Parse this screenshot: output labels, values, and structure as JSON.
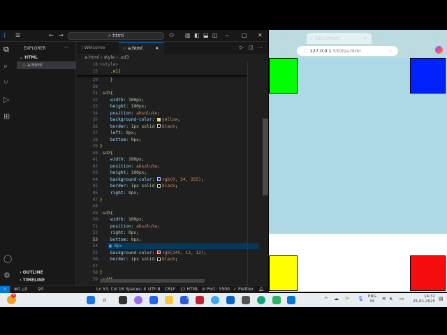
{
  "vscode": {
    "search": "html",
    "explorer_label": "EXPLORER",
    "folder": "HTML",
    "file": "a.html",
    "outline": "OUTLINE",
    "timeline": "TIMELINE",
    "tabs": [
      {
        "label": "Welcome"
      },
      {
        "label": "a.html"
      }
    ],
    "breadcrumb": [
      "a.html",
      "style",
      ".sd3"
    ],
    "sticky": [
      {
        "n": "18",
        "t": "<style>"
      },
      {
        "n": "25",
        "t": "    .m1{"
      }
    ],
    "lines": [
      {
        "n": "29",
        "segs": [
          [
            "    }",
            "br"
          ]
        ]
      },
      {
        "n": "30",
        "segs": []
      },
      {
        "n": "31",
        "segs": [
          [
            ".sd1",
            "sel"
          ],
          [
            "{",
            "br"
          ]
        ]
      },
      {
        "n": "32",
        "segs": [
          [
            "    width",
            "prop"
          ],
          [
            ": ",
            "pun"
          ],
          [
            "100px",
            "num"
          ],
          [
            ";",
            "pun"
          ]
        ]
      },
      {
        "n": "33",
        "segs": [
          [
            "    height",
            "prop"
          ],
          [
            ": ",
            "pun"
          ],
          [
            "100px",
            "num"
          ],
          [
            ";",
            "pun"
          ]
        ]
      },
      {
        "n": "34",
        "segs": [
          [
            "    position",
            "prop"
          ],
          [
            ": ",
            "pun"
          ],
          [
            "absolute",
            "val"
          ],
          [
            ";",
            "pun"
          ]
        ]
      },
      {
        "n": "35",
        "segs": [
          [
            "    background-color",
            "prop"
          ],
          [
            ": ",
            "pun"
          ],
          [
            "yellow",
            "val",
            "#ffff00"
          ],
          [
            ";",
            "pun"
          ]
        ]
      },
      {
        "n": "36",
        "segs": [
          [
            "    border",
            "prop"
          ],
          [
            ": ",
            "pun"
          ],
          [
            "1px solid ",
            "num"
          ],
          [
            "black",
            "val",
            "#000000"
          ],
          [
            ";",
            "pun"
          ]
        ]
      },
      {
        "n": "37",
        "segs": [
          [
            "    left",
            "prop"
          ],
          [
            ": ",
            "pun"
          ],
          [
            "0px",
            "num"
          ],
          [
            ";",
            "pun"
          ]
        ]
      },
      {
        "n": "38",
        "segs": [
          [
            "    bottom",
            "prop"
          ],
          [
            ": ",
            "pun"
          ],
          [
            "0px",
            "num"
          ],
          [
            ";",
            "pun"
          ]
        ]
      },
      {
        "n": "39",
        "segs": [
          [
            "}",
            "br"
          ]
        ]
      },
      {
        "n": "40",
        "segs": [
          [
            ".sd2",
            "sel"
          ],
          [
            "{",
            "br"
          ]
        ]
      },
      {
        "n": "41",
        "segs": [
          [
            "    width",
            "prop"
          ],
          [
            ": ",
            "pun"
          ],
          [
            "100px",
            "num"
          ],
          [
            ";",
            "pun"
          ]
        ]
      },
      {
        "n": "42",
        "segs": [
          [
            "    position",
            "prop"
          ],
          [
            ": ",
            "pun"
          ],
          [
            "absolute",
            "val"
          ],
          [
            ";",
            "pun"
          ]
        ]
      },
      {
        "n": "43",
        "segs": [
          [
            "    height",
            "prop"
          ],
          [
            ": ",
            "pun"
          ],
          [
            "100px",
            "num"
          ],
          [
            ";",
            "pun"
          ]
        ]
      },
      {
        "n": "44",
        "segs": [
          [
            "    background-color",
            "prop"
          ],
          [
            ": ",
            "pun"
          ],
          [
            "rgb(0, 34, 255)",
            "val",
            "#0022ff"
          ],
          [
            ";",
            "pun"
          ]
        ]
      },
      {
        "n": "45",
        "segs": [
          [
            "    border",
            "prop"
          ],
          [
            ": ",
            "pun"
          ],
          [
            "1px solid ",
            "num"
          ],
          [
            "black",
            "val",
            "#000000"
          ],
          [
            ";",
            "pun"
          ]
        ]
      },
      {
        "n": "46",
        "segs": [
          [
            "    right",
            "prop"
          ],
          [
            ": ",
            "pun"
          ],
          [
            "0px",
            "num"
          ],
          [
            ";",
            "pun"
          ]
        ]
      },
      {
        "n": "47",
        "segs": [
          [
            "}",
            "br"
          ]
        ]
      },
      {
        "n": "48",
        "segs": []
      },
      {
        "n": "49",
        "segs": [
          [
            ".sd3",
            "sel"
          ],
          [
            "{",
            "br"
          ]
        ]
      },
      {
        "n": "50",
        "segs": [
          [
            "    width",
            "prop"
          ],
          [
            ": ",
            "pun"
          ],
          [
            "100px",
            "num"
          ],
          [
            ";",
            "pun"
          ]
        ]
      },
      {
        "n": "51",
        "segs": [
          [
            "    position",
            "prop"
          ],
          [
            ": ",
            "pun"
          ],
          [
            "absolute",
            "val"
          ],
          [
            ";",
            "pun"
          ]
        ]
      },
      {
        "n": "52",
        "segs": [
          [
            "    right",
            "prop"
          ],
          [
            ": ",
            "pun"
          ],
          [
            "0px",
            "num"
          ],
          [
            ";",
            "pun"
          ]
        ]
      },
      {
        "n": "53",
        "segs": [
          [
            "    bottom",
            "prop"
          ],
          [
            ": ",
            "pun"
          ],
          [
            "0px",
            "num"
          ],
          [
            ";",
            "pun"
          ]
        ]
      },
      {
        "n": "54",
        "segs": []
      },
      {
        "n": "55",
        "segs": [
          [
            "    background-color",
            "prop"
          ],
          [
            ": ",
            "pun"
          ],
          [
            "rgb(245, 12, 12)",
            "val",
            "#f50c0c"
          ],
          [
            ";",
            "pun"
          ]
        ]
      },
      {
        "n": "56",
        "segs": [
          [
            "    border",
            "prop"
          ],
          [
            ": ",
            "pun"
          ],
          [
            "1px solid ",
            "num"
          ],
          [
            "black",
            "val",
            "#000000"
          ],
          [
            ";",
            "pun"
          ]
        ]
      },
      {
        "n": "57",
        "segs": []
      },
      {
        "n": "58",
        "segs": [
          [
            "}",
            "br"
          ]
        ]
      },
      {
        "n": "59",
        "segs": [
          [
            ".sd4",
            "sel"
          ],
          [
            "{",
            "br"
          ]
        ]
      }
    ],
    "suggestion": "0px",
    "status": {
      "errors": "0",
      "warnings": "0",
      "ports": "0",
      "position": "Ln 53, Col 16",
      "spaces": "Spaces: 4",
      "encoding": "UTF-8",
      "eol": "CRLF",
      "language": "HTML",
      "port": "Port : 5500",
      "prettier": "Prettier"
    }
  },
  "browser": {
    "tab_title": "Document",
    "url_host": "127.0.0.1",
    "url_rest": ":5500/a.html",
    "page_bg": "#add8e6",
    "boxes": {
      "green": "#00ff00",
      "blue": "#0022ff",
      "yellow": "#ffff00",
      "red": "#f50c0c"
    }
  },
  "taskbar": {
    "notification_badge": "4",
    "lang": "ENG",
    "region": "IN",
    "time": "14:32",
    "date": "25-01-2025",
    "app_badge": "2"
  }
}
